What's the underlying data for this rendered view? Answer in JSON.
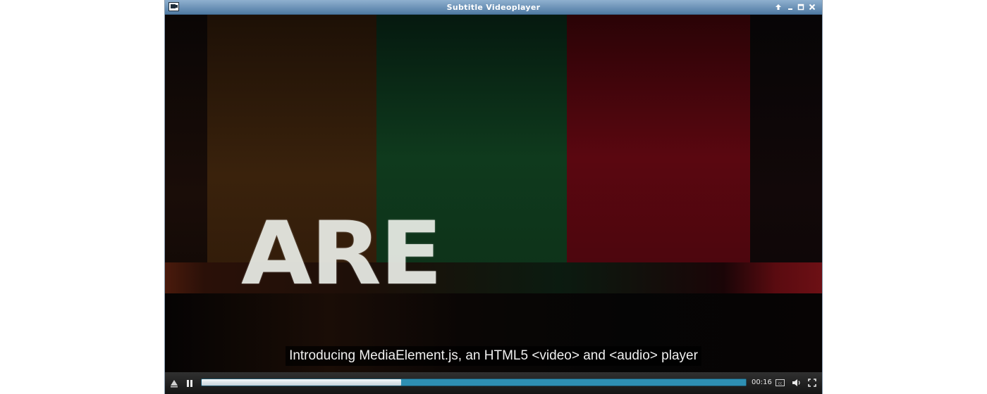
{
  "window": {
    "title": "Subtitle Videoplayer"
  },
  "video": {
    "overlay_text": "ARE",
    "subtitle": "Introducing MediaElement.js, an HTML5 <video> and <audio> player"
  },
  "controls": {
    "current_time": "00:16",
    "progress_played_fraction": 0.366,
    "play_state": "playing"
  },
  "icons": {
    "app": "camera-icon",
    "titlebar": [
      "maximize-arrow-icon",
      "minimize-icon",
      "restore-icon",
      "close-icon"
    ],
    "player": [
      "loop-icon",
      "pause-icon",
      "captions-icon",
      "volume-icon",
      "fullscreen-icon"
    ]
  },
  "colors": {
    "titlebar": "#6b8fb4",
    "progress": "#2a7f9e",
    "played": "#e6ecf0"
  }
}
